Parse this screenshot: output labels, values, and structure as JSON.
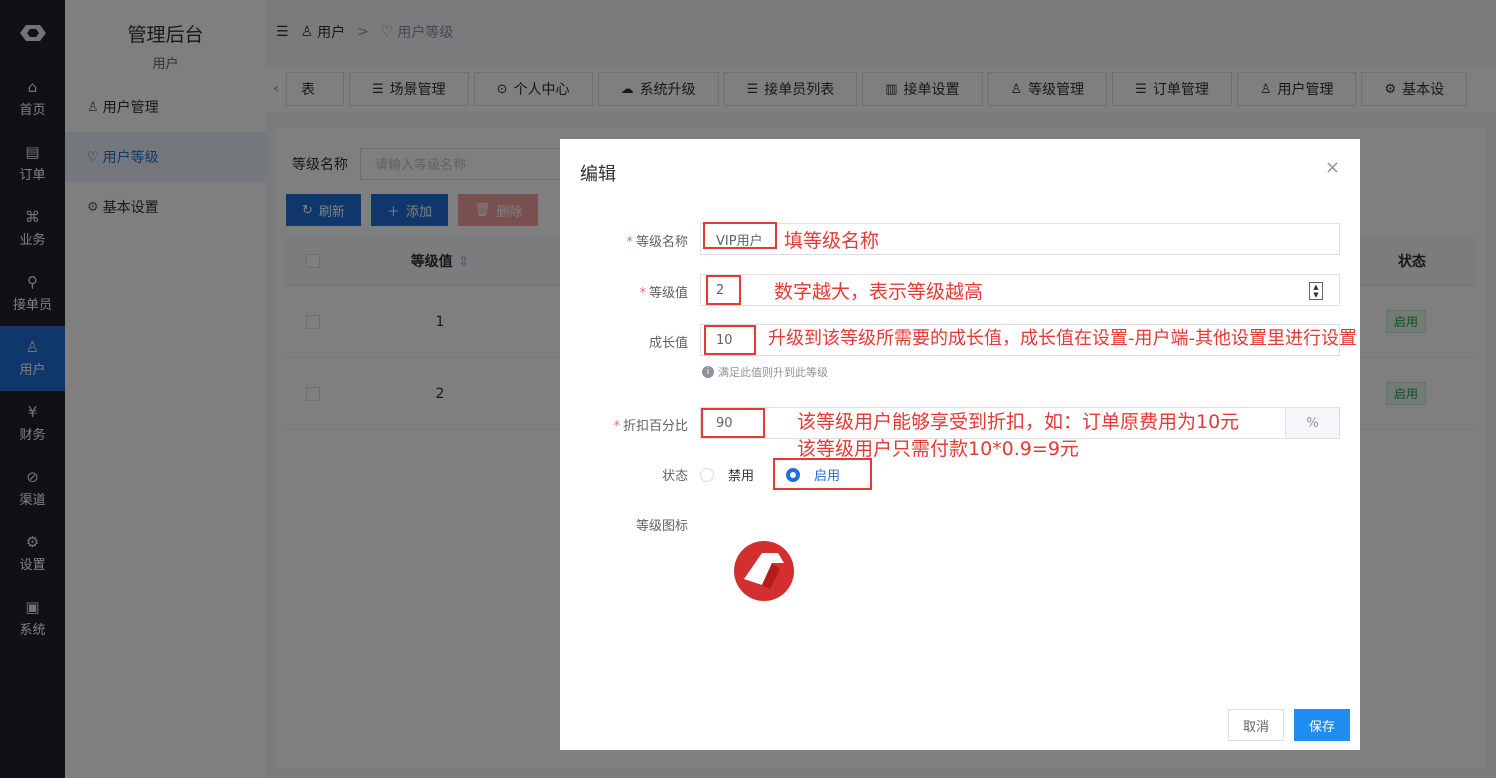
{
  "nav": {
    "items": [
      {
        "label": "首页",
        "icon": "home-icon",
        "glyph": "⌂"
      },
      {
        "label": "订单",
        "icon": "order-icon",
        "glyph": "▤"
      },
      {
        "label": "业务",
        "icon": "grid-icon",
        "glyph": "⌘"
      },
      {
        "label": "接单员",
        "icon": "bike-icon",
        "glyph": "⚲"
      },
      {
        "label": "用户",
        "icon": "user-icon",
        "glyph": "♙"
      },
      {
        "label": "财务",
        "icon": "money-icon",
        "glyph": "¥"
      },
      {
        "label": "渠道",
        "icon": "compass-icon",
        "glyph": "⊘"
      },
      {
        "label": "设置",
        "icon": "settings-icon",
        "glyph": "⚙"
      },
      {
        "label": "系统",
        "icon": "system-icon",
        "glyph": "▣"
      }
    ],
    "active_index": 4
  },
  "subside": {
    "title": "管理后台",
    "subtitle": "用户",
    "items": [
      {
        "label": "用户管理",
        "icon": "user-icon",
        "glyph": "♙"
      },
      {
        "label": "用户等级",
        "icon": "diamond-icon",
        "glyph": "♡"
      },
      {
        "label": "基本设置",
        "icon": "settings-icon",
        "glyph": "⚙"
      }
    ]
  },
  "breadcrumb": {
    "root": "用户",
    "sep": ">",
    "current": "用户等级"
  },
  "tabs": [
    {
      "label": "表",
      "glyph": ""
    },
    {
      "label": "场景管理",
      "glyph": "☰"
    },
    {
      "label": "个人中心",
      "glyph": "⊙"
    },
    {
      "label": "系统升级",
      "glyph": "☁"
    },
    {
      "label": "接单员列表",
      "glyph": "☰"
    },
    {
      "label": "接单设置",
      "glyph": "▥"
    },
    {
      "label": "等级管理",
      "glyph": "♙"
    },
    {
      "label": "订单管理",
      "glyph": "☰"
    },
    {
      "label": "用户管理",
      "glyph": "♙"
    },
    {
      "label": "基本设",
      "glyph": "⚙"
    }
  ],
  "panel": {
    "search_label": "等级名称",
    "search_placeholder": "请输入等级名称",
    "btn_refresh": "刷新",
    "btn_add": "添加",
    "btn_delete": "删除",
    "col_level": "等级值",
    "col_status": "状态",
    "rows": [
      {
        "level": "1",
        "status": "启用"
      },
      {
        "level": "2",
        "status": "启用"
      }
    ]
  },
  "dialog": {
    "title": "编辑",
    "close": "×",
    "name_label": "等级名称",
    "name_value": "VIP用户",
    "level_label": "等级值",
    "level_value": "2",
    "growth_label": "成长值",
    "growth_value": "10",
    "growth_hint": "满足此值则升到此等级",
    "discount_label": "折扣百分比",
    "discount_value": "90",
    "discount_suffix": "%",
    "status_label": "状态",
    "status_off": "禁用",
    "status_on": "启用",
    "icon_label": "等级图标",
    "cancel": "取消",
    "save": "保存"
  },
  "annotations": {
    "name": "填等级名称",
    "level": "数字越大，表示等级越高",
    "growth": "升级到该等级所需要的成长值，成长值在设置-用户端-其他设置里进行设置",
    "discount_line1": "该等级用户能够享受到折扣，如：订单原费用为10元",
    "discount_line2": "该等级用户只需付款10*0.9=9元"
  },
  "colors": {
    "primary": "#1e6fd9",
    "annotation": "#e53935",
    "nav_bg": "#20222a"
  }
}
